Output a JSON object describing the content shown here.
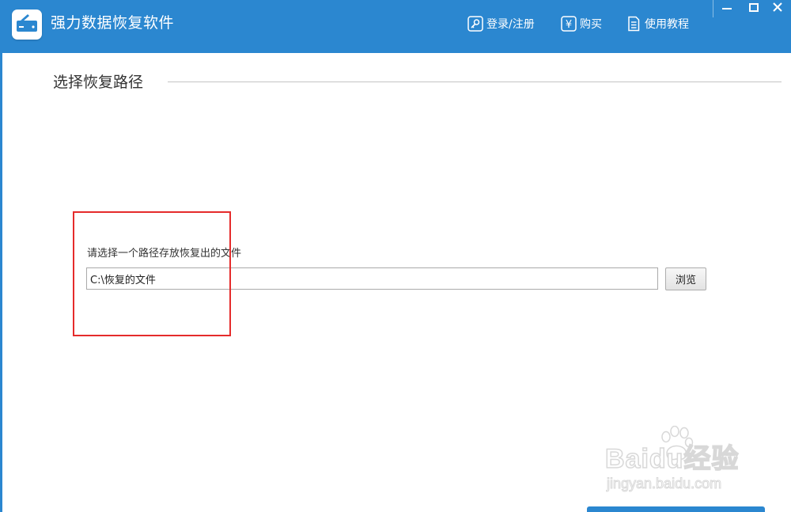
{
  "app": {
    "title": "强力数据恢复软件"
  },
  "topnav": {
    "login_label": "登录/注册",
    "buy_label": "购买",
    "tutorial_label": "使用教程"
  },
  "window_controls": {
    "minimize_icon": "minimize-icon",
    "maximize_icon": "maximize-icon",
    "close_icon": "close-icon"
  },
  "main": {
    "section_title": "选择恢复路径",
    "path_label": "请选择一个路径存放恢复出的文件",
    "path_value": "C:\\恢复的文件",
    "browse_label": "浏览"
  },
  "watermark": {
    "brand": "Baidu经验",
    "url": "jingyan.baidu.com"
  },
  "colors": {
    "titlebar": "#2b87d0",
    "highlight": "#e52b2b",
    "text": "#333333"
  }
}
